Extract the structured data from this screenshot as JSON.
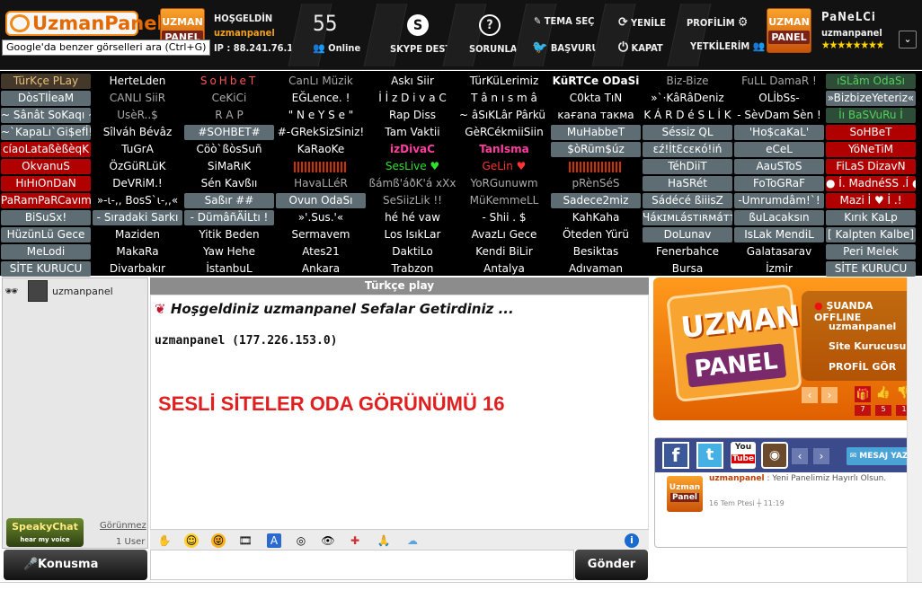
{
  "header": {
    "logo_text": "UzmanPanel",
    "welcome_label": "HOŞGELDİN",
    "username": "uzmanpanel",
    "ip_text": "IP : 88.241.76.128",
    "online_count": "55",
    "online_label": "Online",
    "skype_label": "SKYPE DESTEK",
    "faq_label": "SORUNLAR",
    "theme_label": "TEMA SEÇ",
    "apply_label": "BAŞVURU",
    "refresh_label": "YENİLE",
    "close_label": "KAPAT",
    "profile_label": "PROFİLİM",
    "links_label": "YETKİLERİM",
    "panel_name": "PaNeLCi",
    "panel_user": "uzmanpanel",
    "stars": "★★★★★★★★",
    "uzman_box_top": "UZMAN",
    "uzman_box_bottom": "PANEL",
    "tooltip": "Google'da benzer görselleri ara (Ctrl+G)"
  },
  "rooms": [
    [
      "TürKçe PLay",
      "HerteLden",
      "SoHbeT",
      "CanLı Müzik",
      "Askı Siir",
      "TürKüLerimiz",
      "KüRTCe ODaSi",
      "Biz-Bize",
      "FuLL DamaR !",
      "ıSLâm OdaSı"
    ],
    [
      "DòsTlİeaM",
      "CANLI SiiR",
      "CeKiCi",
      "EĞLence. !",
      "İ İ z D i v a C",
      "T â n ı s m â",
      "C0kta TıN",
      "»`·KâRâDeniz",
      "OLİbSs-",
      "»BizbizeYeteriz«"
    ],
    [
      "~ Sânât SoKaqı ~",
      "UsèR..$",
      "R A P",
      "\" N e Y S e \"",
      "Rap Diss",
      "~ âSıKLâr Pârkü ~",
      "ĸaғana тaĸмa",
      "K Á R D é S L İ K",
      "- SèvDam Sèn !",
      "İı BaSVuRu İ"
    ],
    [
      "~`KapaLı`Gi$efİ!",
      "Sîlváh Bévâz",
      "#SOHBET#",
      "#-GRekSizSiniz!",
      "Tam Vaktii",
      "GèRCékmiiSiin",
      "MuHabbeT",
      "Séssiz QL",
      "'Ho$caKaL'",
      "SoHBeT"
    ],
    [
      "cíaoLataßèßèqK",
      "TuGrA",
      "Cöò`ßòsSuñ",
      "KaRaoKe",
      "izDivaC",
      "TanIsma",
      "$òRüm$úz",
      "ɛź!İtƐcɛкó!iń",
      "eCeL",
      "YöNeTiM"
    ],
    [
      "OkvanuS",
      "ÖzGüRLüK",
      "SiMaRıK",
      "",
      "SesLive ♥",
      "GeLin ♥",
      "",
      "TéhDiiT",
      "AauSToS",
      "FiLaS DizavN"
    ],
    [
      "HıHıOnDaN",
      "DeVRiM.!",
      "Sén Kavßıı",
      "HavaLLéR",
      "ßámß'áðK'á xXx",
      "YoRGunuwm",
      "pRènSéS",
      "HaSRét",
      "FoToGRaF",
      "● Í. MadnéSS .Í ●"
    ],
    [
      "PaRamPaRCavım",
      "»-ι-,, BosS`ι-,,«",
      "Saßır ##",
      "Ovun OdaSı",
      "SeSiizLik !!",
      "MüKemmeLL",
      "Sadece2miz",
      "Sádécé ßiiisZ",
      "-Umrumdâm!`!",
      "Mazi İ ♥ İ .!"
    ],
    [
      "BiSuSx!",
      "- Sıradaki Sarkı",
      "- DümâñÄİLtı !",
      "»'.Sus.'«",
      "hé hé vaw",
      "- Shii . $",
      "KahKaha",
      "Ɥáĸɪмʟásтıʀмáттı",
      "ßuLacaksın",
      "Kırık KaLp"
    ],
    [
      "HüzünLü Gece",
      "Maziden",
      "Yitik Beden",
      "Sermavem",
      "Los IsıkLar",
      "AvazLı Gece",
      "Öteden Yürü",
      "DoLunav",
      "IsLak MendiL",
      "[ Kalpten Kalbe]"
    ],
    [
      "MeLodi",
      "MakaRa",
      "Yaw Hehe",
      "Ates21",
      "DaktiLo",
      "Kendi BiLir",
      "Besiktas",
      "Fenerbahce",
      "Galatasarav",
      "Peri Melek"
    ],
    [
      "SİTE KURUCU",
      "Divarbakır",
      "İstanbuL",
      "Ankara",
      "Trabzon",
      "Antalya",
      "Adıvaman",
      "Bursa",
      "İzmir",
      "SİTE KURUCU"
    ]
  ],
  "user_list": {
    "username": "uzmanpanel",
    "logo_text": "SpeakyChat",
    "logo_sub": "hear my voice",
    "visible_label": "Görünmez",
    "user_count": "1 User"
  },
  "chat": {
    "room_title": "Türkçe play",
    "welcome_msg": "Hoşgeldiniz uzmanpanel Sefalar Getirdiniz ...",
    "ip_line": "uzmanpanel (177.226.153.0)",
    "big_title": "SESLİ SİTELER ODA GÖRÜNÜMÜ 16",
    "talk_label": "Konusma",
    "send_label": "Gönder"
  },
  "promo": {
    "brand_top": "UZMAN",
    "brand_bottom": "PANEL",
    "status": "ŞUANDA OFFLINE",
    "user": "uzmanpanel",
    "founder": "Site Kurucusu",
    "profile": "PROFİL GÖR",
    "gift_count": "7",
    "like_count": "5",
    "dislike_count": "1"
  },
  "social": {
    "fb": "f",
    "tw": "t",
    "yt_top": "You",
    "yt_bottom": "Tube",
    "msg_label": "MESAJ YAZ",
    "post_user": "uzmanpanel",
    "post_text": ": Yeni Panelimiz Hayırlı Olsun.",
    "post_date": "16 Tem Ptesi ┼ 11:19",
    "avatar_top": "Uzman",
    "avatar_bottom": "Panel"
  },
  "colors": {
    "accent": "#f08a18",
    "dark": "#121212",
    "room_grey": "#5e6d74",
    "room_red": "#b00000",
    "chat_red": "#e02020"
  }
}
